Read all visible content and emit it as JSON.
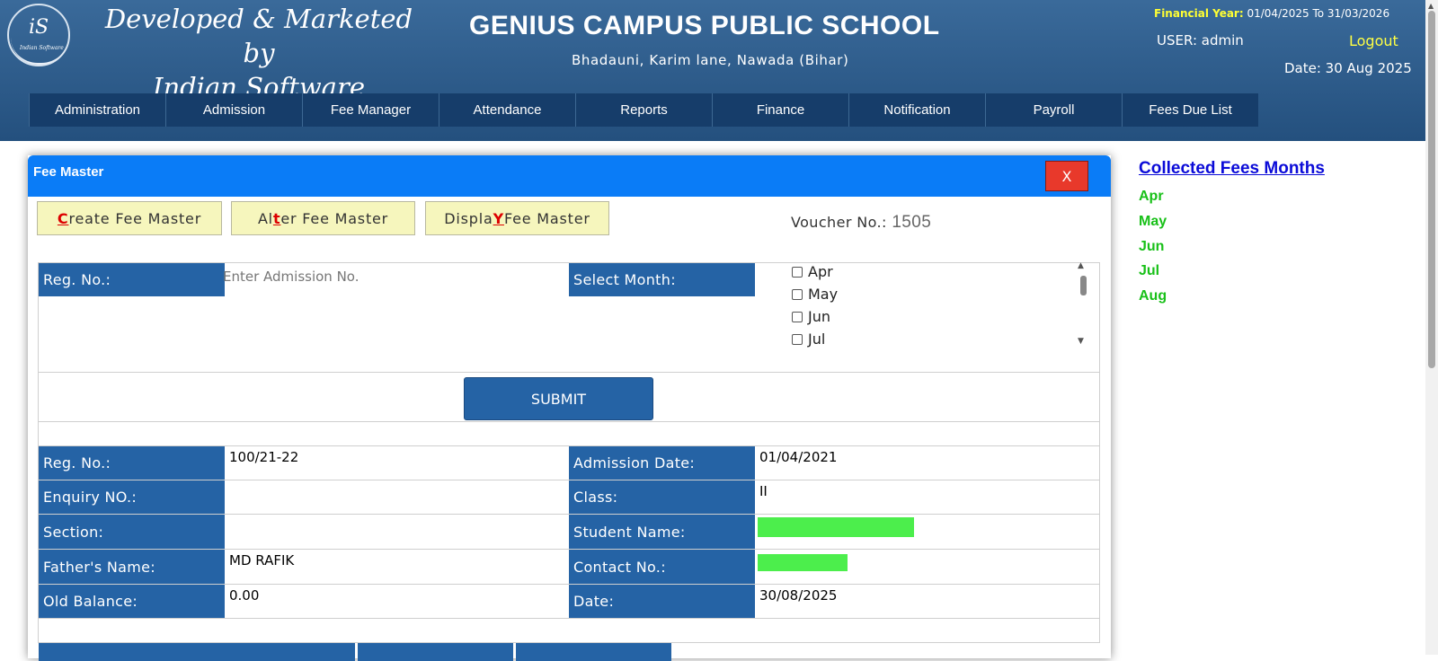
{
  "header": {
    "logo_text": "iS",
    "logo_subtext": "Indian Software",
    "developer_line1": "Developed & Marketed by",
    "developer_line2": "Indian Software",
    "school_name": "GENIUS CAMPUS PUBLIC SCHOOL",
    "address": "Bhadauni, Karim lane, Nawada (Bihar)",
    "financial_year_label": "Financial Year:",
    "financial_year_value": "01/04/2025 To 31/03/2026",
    "user_text": "USER: admin",
    "logout_label": "Logout",
    "date_text": "Date: 30 Aug 2025"
  },
  "nav": {
    "items": [
      "Administration",
      "Admission",
      "Fee Manager",
      "Attendance",
      "Reports",
      "Finance",
      "Notification",
      "Payroll",
      "Fees Due List"
    ]
  },
  "panel": {
    "title": "Fee Master",
    "close_label": "X",
    "buttons": {
      "create_pre": "",
      "create_acc": "C",
      "create_post": "reate Fee Master",
      "alter_pre": "Al",
      "alter_acc": "t",
      "alter_post": "er Fee Master",
      "display_pre": "Displa",
      "display_acc": "Y",
      "display_post": " Fee Master"
    },
    "voucher_label": "Voucher No.:",
    "voucher_value": "1505",
    "search": {
      "reg_label": "Reg. No.:",
      "reg_placeholder": "Enter Admission No.",
      "month_label": "Select Month:",
      "months": [
        "Apr",
        "May",
        "Jun",
        "Jul"
      ]
    },
    "submit_label": "SUBMIT",
    "details": {
      "reg_no_label": "Reg. No.:",
      "reg_no_value": "100/21-22",
      "admission_date_label": "Admission Date:",
      "admission_date_value": "01/04/2021",
      "enquiry_label": "Enquiry NO.:",
      "enquiry_value": "",
      "class_label": "Class:",
      "class_value": "II",
      "section_label": "Section:",
      "section_value": "",
      "student_name_label": "Student Name:",
      "father_label": "Father's Name:",
      "father_value": "MD RAFIK",
      "contact_label": "Contact No.:",
      "old_balance_label": "Old Balance:",
      "old_balance_value": "0.00",
      "date_label": "Date:",
      "date_value": "30/08/2025"
    }
  },
  "collected": {
    "title": "Collected Fees Months",
    "months": [
      "Apr",
      "May",
      "Jun",
      "Jul",
      "Aug"
    ]
  },
  "colors": {
    "header_bg": "#2d5c8c",
    "nav_bg": "#163d6a",
    "panel_head": "#0a7cf7",
    "label_cell": "#2563a5",
    "accent_green": "#18c018",
    "redacted_green": "#4cee4c",
    "close_red": "#e8392b"
  }
}
